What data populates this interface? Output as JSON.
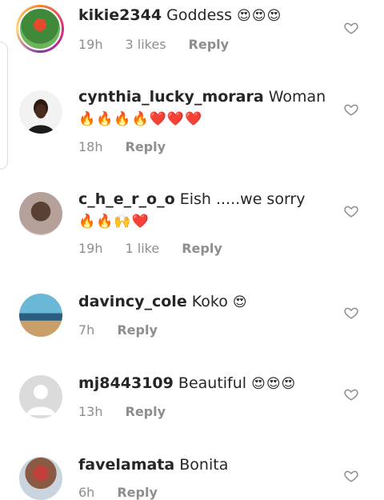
{
  "comments": [
    {
      "username": "kikie2344",
      "text": "Goddess",
      "emoji": "😍😍😍",
      "time": "19h",
      "likes": "3 likes",
      "reply": "Reply"
    },
    {
      "username": "cynthia_lucky_morara",
      "text": "Woman",
      "emoji": "🔥🔥🔥🔥❤️❤️❤️",
      "time": "18h",
      "likes": "",
      "reply": "Reply"
    },
    {
      "username": "c_h_e_r_o_o",
      "text": "Eish .....we sorry",
      "emoji": "🔥🔥🙌❤️",
      "time": "19h",
      "likes": "1 like",
      "reply": "Reply"
    },
    {
      "username": "davincy_cole",
      "text": "Koko",
      "emoji": "😍",
      "time": "7h",
      "likes": "",
      "reply": "Reply"
    },
    {
      "username": "mj8443109",
      "text": "Beautiful",
      "emoji": "😍😍😍",
      "time": "13h",
      "likes": "",
      "reply": "Reply"
    },
    {
      "username": "favelamata",
      "text": "Bonita",
      "emoji": "",
      "time": "6h",
      "likes": "",
      "reply": "Reply"
    }
  ],
  "colors": {
    "text": "#262626",
    "meta": "#8e8e8e",
    "heart_stroke": "#8e8e8e"
  },
  "icons": {
    "like": "heart-outline-icon"
  }
}
